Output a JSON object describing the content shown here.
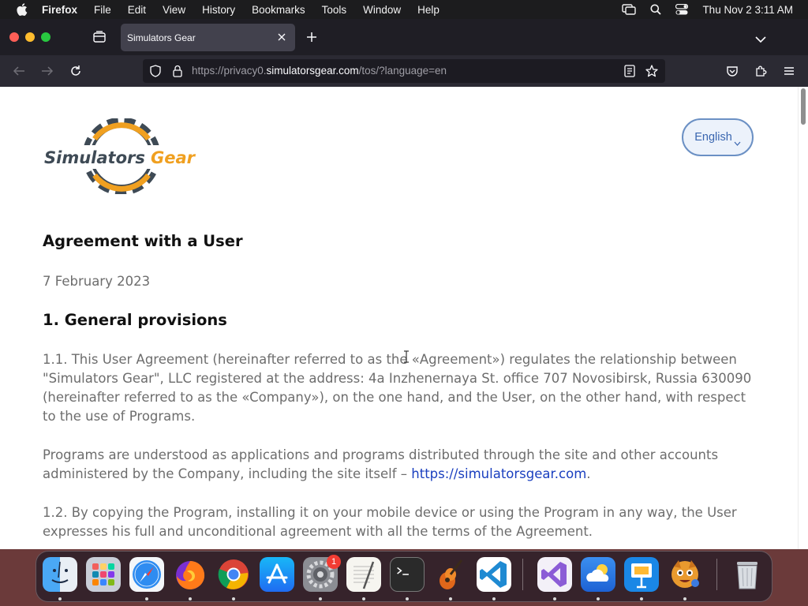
{
  "menubar": {
    "app_name": "Firefox",
    "menus": [
      "File",
      "Edit",
      "View",
      "History",
      "Bookmarks",
      "Tools",
      "Window",
      "Help"
    ],
    "clock": "Thu Nov 2  3:11 AM"
  },
  "browser": {
    "tab_title": "Simulators Gear",
    "url_prefix": "https://privacy0.",
    "url_host": "simulatorsgear.com",
    "url_path": "/tos/?language=en"
  },
  "page": {
    "logo_text": "Simulators Gear",
    "language_button": "English",
    "title": "Agreement with a User",
    "date": "7 February 2023",
    "section_heading": "1. General provisions",
    "paragraph_1": "1.1. This User Agreement (hereinafter referred to as the «Agreement») regulates the relationship between \"Simulators Gear\", LLC registered at the address: 4a Inzhenernaya St. office 707 Novosibirsk, Russia 630090 (hereinafter referred to as the «Company»), on the one hand, and the User, on the other hand, with respect to the use of Programs.",
    "paragraph_2_text": "Programs are understood as applications and programs distributed through the site and other accounts administered by the Company, including the site itself – ",
    "paragraph_2_link": "https://simulatorsgear.com",
    "paragraph_2_end": ".",
    "paragraph_3": "1.2. By copying the Program, installing it on your mobile device or using the Program in any way, the User expresses his full and unconditional agreement with all the terms of the Agreement."
  },
  "dock": {
    "apps": [
      "finder",
      "launchpad",
      "safari",
      "firefox",
      "chrome",
      "app-store",
      "system-settings",
      "textedit",
      "terminal",
      "garageband",
      "vscode",
      "visual-studio",
      "icloud-weather",
      "keynote",
      "game"
    ],
    "settings_badge": "1"
  },
  "colors": {
    "accent_blue": "#3a66b0",
    "link_blue": "#1a3fbf",
    "logo_orange": "#f0a020",
    "logo_gray": "#3e4a55"
  }
}
